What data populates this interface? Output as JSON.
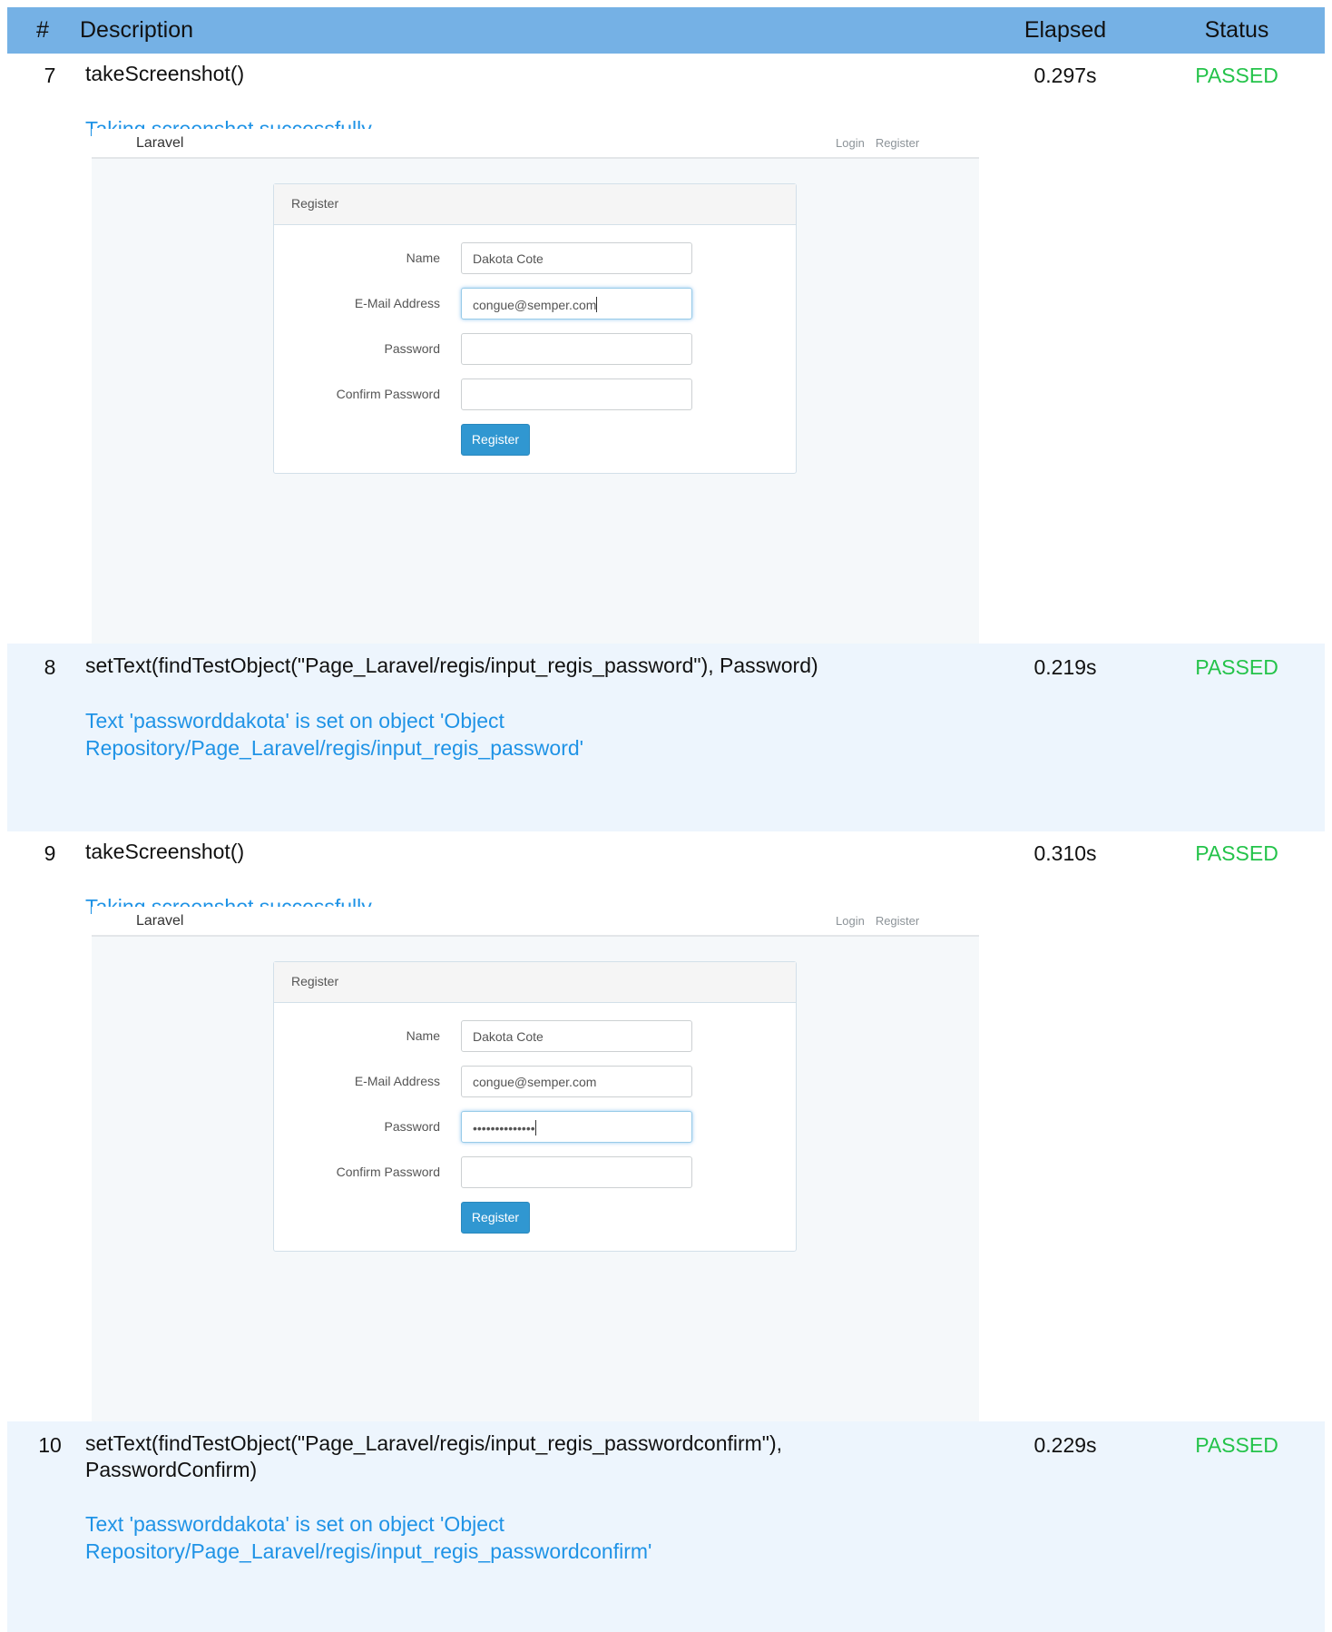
{
  "header": {
    "num": "#",
    "description": "Description",
    "elapsed": "Elapsed",
    "status": "Status"
  },
  "steps": [
    {
      "num": "7",
      "description": "takeScreenshot()",
      "elapsed": "0.297s",
      "status": "PASSED",
      "message": "Taking screenshot successfully",
      "screenshot": {
        "brand": "Laravel",
        "nav_login": "Login",
        "nav_register": "Register",
        "panel_title": "Register",
        "labels": {
          "name": "Name",
          "email": "E-Mail Address",
          "password": "Password",
          "confirm": "Confirm Password"
        },
        "values": {
          "name": "Dakota Cote",
          "email": "congue@semper.com",
          "password": "",
          "confirm": ""
        },
        "button": "Register"
      }
    },
    {
      "num": "8",
      "description": "setText(findTestObject(\"Page_Laravel/regis/input_regis_password\"), Password)",
      "elapsed": "0.219s",
      "status": "PASSED",
      "message": "Text 'passworddakota' is set on object 'Object Repository/Page_Laravel/regis/input_regis_password'"
    },
    {
      "num": "9",
      "description": "takeScreenshot()",
      "elapsed": "0.310s",
      "status": "PASSED",
      "message": "Taking screenshot successfully",
      "screenshot": {
        "brand": "Laravel",
        "nav_login": "Login",
        "nav_register": "Register",
        "panel_title": "Register",
        "labels": {
          "name": "Name",
          "email": "E-Mail Address",
          "password": "Password",
          "confirm": "Confirm Password"
        },
        "values": {
          "name": "Dakota Cote",
          "email": "congue@semper.com",
          "password": "••••••••••••••",
          "confirm": ""
        },
        "button": "Register"
      }
    },
    {
      "num": "10",
      "description": "setText(findTestObject(\"Page_Laravel/regis/input_regis_passwordconfirm\"), PasswordConfirm)",
      "elapsed": "0.229s",
      "status": "PASSED",
      "message": "Text 'passworddakota' is set on object 'Object Repository/Page_Laravel/regis/input_regis_passwordconfirm'"
    }
  ],
  "colors": {
    "header_bg": "#75b1e5",
    "alt_row_bg": "#edf5fd",
    "passed": "#24c34a",
    "message": "#1f93e6",
    "button": "#3097d1"
  }
}
